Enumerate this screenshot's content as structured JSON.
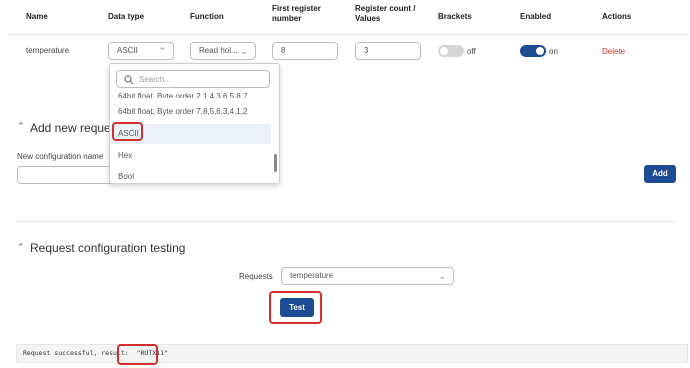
{
  "table": {
    "headers": {
      "name": "Name",
      "data_type": "Data type",
      "function": "Function",
      "first_register": [
        "First register",
        "number"
      ],
      "register_count": [
        "Register count /",
        "Values"
      ],
      "brackets": "Brackets",
      "enabled": "Enabled",
      "actions": "Actions"
    },
    "row": {
      "name": "temperature",
      "data_type": "ASCII",
      "function": "Read hol...",
      "first_register": "8",
      "register_count": "3",
      "brackets_state": "off",
      "enabled_state": "on",
      "delete_label": "Delete"
    }
  },
  "dropdown": {
    "search_placeholder": "Search...",
    "items": [
      "64bit float, Byte order 2,1,4,3,6,5,8,7",
      "64bit float, Byte order 7,8,5,6,3,4,1,2",
      "ASCII",
      "Hex",
      "Bool"
    ],
    "selected": "ASCII"
  },
  "add_section": {
    "title": "Add new reque",
    "field_label": "New configuration name",
    "field_value": "",
    "add_label": "Add"
  },
  "testing_section": {
    "title": "Request configuration testing",
    "requests_label": "Requests",
    "requests_value": "temperature",
    "test_label": "Test",
    "result_prefix": "Request successful, result:",
    "result_value": "\"RUTX11\""
  },
  "colors": {
    "primary": "#1e4c94",
    "danger": "#d32f2f",
    "highlight": "#d32f2f"
  }
}
